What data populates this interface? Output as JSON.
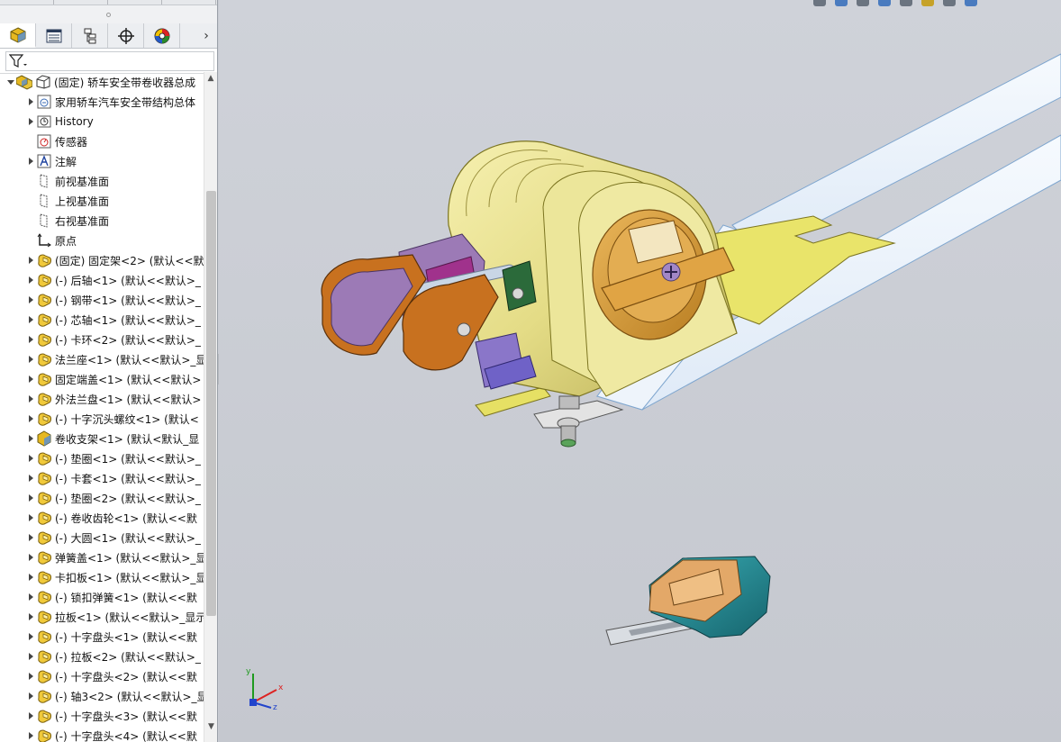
{
  "feature_tree": {
    "tabs": [
      {
        "name": "featuremanager-tab",
        "icon": "part-cube-icon"
      },
      {
        "name": "propertymanager-tab",
        "icon": "property-sheet-icon"
      },
      {
        "name": "configurationmanager-tab",
        "icon": "configuration-icon"
      },
      {
        "name": "dimxpert-tab",
        "icon": "crosshair-icon"
      },
      {
        "name": "display-manager-tab",
        "icon": "appearance-pie-icon"
      }
    ],
    "more_tabs_arrow": "›",
    "filter_icon": "filter-icon",
    "items": [
      {
        "label": "(固定) 轿车安全带卷收器总成",
        "level": 0,
        "expand": "down",
        "icon": "assembly-icon"
      },
      {
        "label": "家用轿车汽车安全带结构总体",
        "level": 1,
        "expand": "right",
        "icon": "document-folder-icon"
      },
      {
        "label": "History",
        "level": 1,
        "expand": "right",
        "icon": "history-icon"
      },
      {
        "label": "传感器",
        "level": 1,
        "expand": "none",
        "icon": "sensor-icon"
      },
      {
        "label": "注解",
        "level": 1,
        "expand": "right",
        "icon": "annotation-icon"
      },
      {
        "label": "前视基准面",
        "level": 1,
        "expand": "none",
        "icon": "plane-icon"
      },
      {
        "label": "上视基准面",
        "level": 1,
        "expand": "none",
        "icon": "plane-icon"
      },
      {
        "label": "右视基准面",
        "level": 1,
        "expand": "none",
        "icon": "plane-icon"
      },
      {
        "label": "原点",
        "level": 1,
        "expand": "none",
        "icon": "origin-icon"
      },
      {
        "label": "(固定) 固定架<2> (默认<<默",
        "level": 1,
        "expand": "right",
        "icon": "part-icon"
      },
      {
        "label": "(-) 后轴<1> (默认<<默认>_",
        "level": 1,
        "expand": "right",
        "icon": "part-icon"
      },
      {
        "label": "(-) 钢带<1> (默认<<默认>_",
        "level": 1,
        "expand": "right",
        "icon": "part-icon"
      },
      {
        "label": "(-) 芯轴<1> (默认<<默认>_",
        "level": 1,
        "expand": "right",
        "icon": "part-icon"
      },
      {
        "label": "(-) 卡环<2> (默认<<默认>_",
        "level": 1,
        "expand": "right",
        "icon": "part-icon"
      },
      {
        "label": "法兰座<1> (默认<<默认>_显",
        "level": 1,
        "expand": "right",
        "icon": "part-icon"
      },
      {
        "label": "固定端盖<1> (默认<<默认>",
        "level": 1,
        "expand": "right",
        "icon": "part-icon"
      },
      {
        "label": "外法兰盘<1> (默认<<默认>",
        "level": 1,
        "expand": "right",
        "icon": "part-icon"
      },
      {
        "label": "(-) 十字沉头螺纹<1> (默认<",
        "level": 1,
        "expand": "right",
        "icon": "part-icon"
      },
      {
        "label": "卷收支架<1> (默认<默认_显",
        "level": 1,
        "expand": "right",
        "icon": "subassembly-icon"
      },
      {
        "label": "(-) 垫圈<1> (默认<<默认>_",
        "level": 1,
        "expand": "right",
        "icon": "part-icon"
      },
      {
        "label": "(-) 卡套<1> (默认<<默认>_",
        "level": 1,
        "expand": "right",
        "icon": "part-icon"
      },
      {
        "label": "(-) 垫圈<2> (默认<<默认>_",
        "level": 1,
        "expand": "right",
        "icon": "part-icon"
      },
      {
        "label": "(-) 卷收齿轮<1> (默认<<默",
        "level": 1,
        "expand": "right",
        "icon": "part-icon"
      },
      {
        "label": "(-) 大圆<1> (默认<<默认>_",
        "level": 1,
        "expand": "right",
        "icon": "part-icon"
      },
      {
        "label": "弹簧盖<1> (默认<<默认>_显",
        "level": 1,
        "expand": "right",
        "icon": "part-icon"
      },
      {
        "label": "卡扣板<1> (默认<<默认>_显",
        "level": 1,
        "expand": "right",
        "icon": "part-icon"
      },
      {
        "label": "(-) 锁扣弹簧<1> (默认<<默",
        "level": 1,
        "expand": "right",
        "icon": "part-icon"
      },
      {
        "label": "拉板<1> (默认<<默认>_显示",
        "level": 1,
        "expand": "right",
        "icon": "part-icon"
      },
      {
        "label": "(-) 十字盘头<1> (默认<<默",
        "level": 1,
        "expand": "right",
        "icon": "part-icon"
      },
      {
        "label": "(-) 拉板<2> (默认<<默认>_",
        "level": 1,
        "expand": "right",
        "icon": "part-icon"
      },
      {
        "label": "(-) 十字盘头<2> (默认<<默",
        "level": 1,
        "expand": "right",
        "icon": "part-icon"
      },
      {
        "label": "(-) 轴3<2> (默认<<默认>_显",
        "level": 1,
        "expand": "right",
        "icon": "part-icon"
      },
      {
        "label": "(-) 十字盘头<3> (默认<<默",
        "level": 1,
        "expand": "right",
        "icon": "part-icon"
      },
      {
        "label": "(-) 十字盘头<4> (默认<<默",
        "level": 1,
        "expand": "right",
        "icon": "part-icon"
      }
    ]
  },
  "triad": {
    "x": "x",
    "y": "y",
    "z": "z"
  },
  "colors": {
    "viewport_bg": "#c9ccd3",
    "housing_yellow": "#e9e28e",
    "knob_orange": "#d8a446",
    "bracket_orange": "#c8711f",
    "plate_purple": "#9c7ab6",
    "accent_magenta": "#a0328c",
    "strap_blue": "#e6f0fb",
    "buckle_teal": "#1f8e98",
    "buckle_tan": "#e3a868"
  }
}
